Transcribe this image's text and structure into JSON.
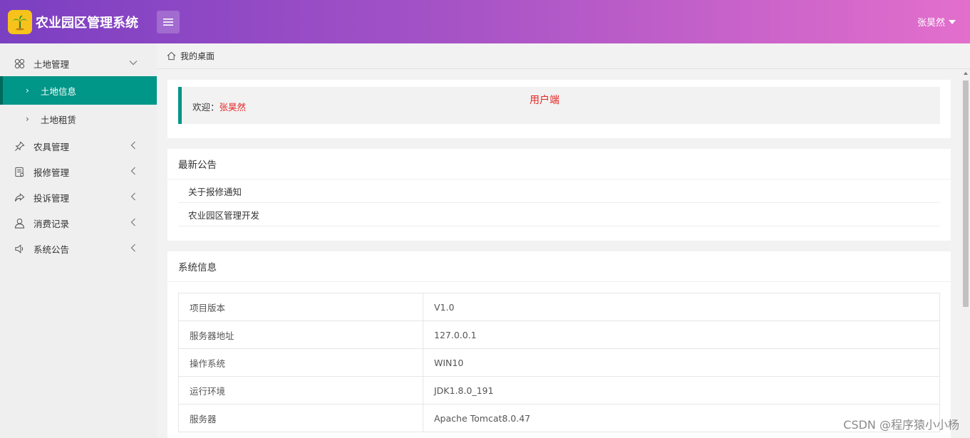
{
  "header": {
    "app_title": "农业园区管理系统",
    "user_name": "张昊然",
    "logo_icon": "palm-tree-icon",
    "menu_icon": "hamburger-icon"
  },
  "sidebar": {
    "items": [
      {
        "label": "土地管理",
        "icon": "clover-icon",
        "expanded": true,
        "children": [
          {
            "label": "土地信息",
            "active": true
          },
          {
            "label": "土地租赁",
            "active": false
          }
        ]
      },
      {
        "label": "农具管理",
        "icon": "pin-icon"
      },
      {
        "label": "报修管理",
        "icon": "form-icon"
      },
      {
        "label": "投诉管理",
        "icon": "share-icon"
      },
      {
        "label": "消费记录",
        "icon": "user-icon"
      },
      {
        "label": "系统公告",
        "icon": "speaker-icon"
      }
    ]
  },
  "breadcrumb": {
    "label": "我的桌面",
    "icon": "home-icon"
  },
  "welcome": {
    "prefix": "欢迎：",
    "name": "张昊然",
    "tag": "用户端"
  },
  "notices": {
    "title": "最新公告",
    "items": [
      "关于报修通知",
      "农业园区管理开发"
    ]
  },
  "system_info": {
    "title": "系统信息",
    "rows": [
      {
        "key": "项目版本",
        "value": "V1.0"
      },
      {
        "key": "服务器地址",
        "value": "127.0.0.1"
      },
      {
        "key": "操作系统",
        "value": "WIN10"
      },
      {
        "key": "运行环境",
        "value": "JDK1.8.0_191"
      },
      {
        "key": "服务器",
        "value": "Apache Tomcat8.0.47"
      }
    ]
  },
  "watermark": "CSDN @程序猿小小杨",
  "colors": {
    "accent": "#009688",
    "header_start": "#7b3fc2",
    "header_end": "#e36fcc",
    "highlight_red": "#e62525"
  }
}
